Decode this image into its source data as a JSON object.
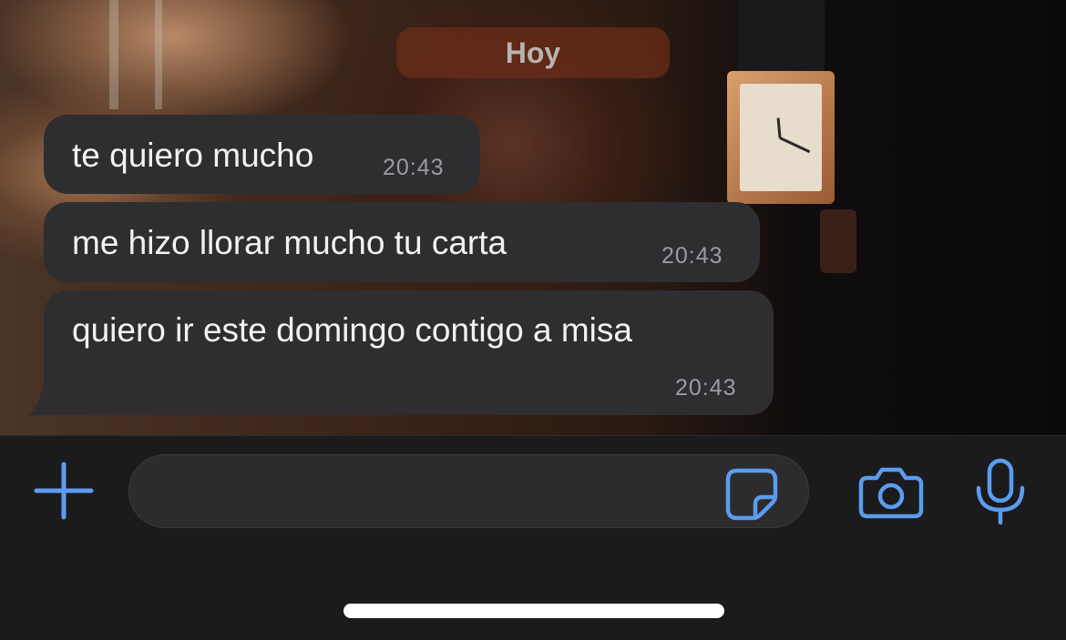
{
  "chat": {
    "date_separator": "Hoy",
    "messages": [
      {
        "text": "te quiero mucho",
        "time": "20:43"
      },
      {
        "text": "me hizo llorar mucho tu carta",
        "time": "20:43"
      },
      {
        "text": "quiero ir este domingo contigo a misa",
        "time": "20:43"
      }
    ]
  },
  "composer": {
    "message_value": "",
    "message_placeholder": "",
    "icons": {
      "attach": "plus-icon",
      "sticker": "sticker-icon",
      "camera": "camera-icon",
      "voice": "microphone-icon"
    },
    "accent_color": "#5b9cf0"
  },
  "colors": {
    "incoming_bubble": "#2e2e30",
    "bar_background": "#1b1b1d",
    "timestamp": "#9b9ba0"
  }
}
